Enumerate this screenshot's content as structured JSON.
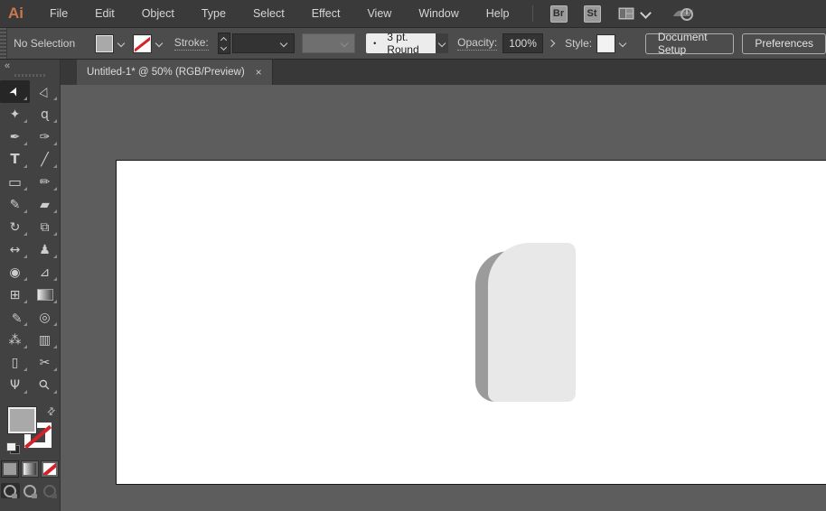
{
  "menubar": {
    "app_logo": "Ai",
    "items": [
      "File",
      "Edit",
      "Object",
      "Type",
      "Select",
      "Effect",
      "View",
      "Window",
      "Help"
    ],
    "bridge_label": "Br",
    "stock_label": "St"
  },
  "controlbar": {
    "selection_status": "No Selection",
    "stroke_label": "Stroke:",
    "brush_dot": "•",
    "brush_value": "3 pt. Round",
    "opacity_label": "Opacity:",
    "opacity_value": "100%",
    "style_label": "Style:",
    "document_setup_label": "Document Setup",
    "preferences_label": "Preferences"
  },
  "toolbar": {
    "collapse_glyph": "«",
    "tools": [
      {
        "name": "selection-tool",
        "glyph": "➤",
        "active": true
      },
      {
        "name": "direct-selection-tool",
        "glyph": "▷"
      },
      {
        "name": "magic-wand-tool",
        "glyph": "✦"
      },
      {
        "name": "lasso-tool",
        "glyph": "ɋ"
      },
      {
        "name": "pen-tool",
        "glyph": "✒"
      },
      {
        "name": "curvature-tool",
        "glyph": "✑"
      },
      {
        "name": "type-tool",
        "glyph": "T"
      },
      {
        "name": "line-segment-tool",
        "glyph": "╱"
      },
      {
        "name": "rectangle-tool",
        "glyph": "▭"
      },
      {
        "name": "paintbrush-tool",
        "glyph": "✏"
      },
      {
        "name": "shaper-tool",
        "glyph": "✎"
      },
      {
        "name": "eraser-tool",
        "glyph": "▰"
      },
      {
        "name": "rotate-tool",
        "glyph": "↻"
      },
      {
        "name": "scale-tool",
        "glyph": "⧉"
      },
      {
        "name": "width-tool",
        "glyph": "↔"
      },
      {
        "name": "puppet-warp-tool",
        "glyph": "♟"
      },
      {
        "name": "shape-builder-tool",
        "glyph": "◉"
      },
      {
        "name": "perspective-grid-tool",
        "glyph": "⊿"
      },
      {
        "name": "mesh-tool",
        "glyph": "⊞"
      },
      {
        "name": "gradient-tool",
        "glyph": "▤"
      },
      {
        "name": "eyedropper-tool",
        "glyph": "✐"
      },
      {
        "name": "blend-tool",
        "glyph": "◎"
      },
      {
        "name": "symbol-sprayer-tool",
        "glyph": "⁂"
      },
      {
        "name": "column-graph-tool",
        "glyph": "▥"
      },
      {
        "name": "artboard-tool",
        "glyph": "▯"
      },
      {
        "name": "slice-tool",
        "glyph": "✂"
      },
      {
        "name": "hand-tool",
        "glyph": "Ψ"
      },
      {
        "name": "zoom-tool",
        "glyph": "⚲"
      }
    ],
    "swap_glyph": "⇄"
  },
  "tabbar": {
    "tab_title": "Untitled-1* @ 50% (RGB/Preview)",
    "close_glyph": "×"
  },
  "canvas": {
    "shape": {
      "type": "rounded-book-shape",
      "body_color": "#e8e8e8",
      "spine_color": "#9b9b9b"
    },
    "artboard_color": "#ffffff",
    "background_color": "#5d5d5d"
  },
  "colors": {
    "menubar_bg": "#3a3a3a",
    "controlbar_bg": "#4c4c4c",
    "toolbar_bg": "#424242",
    "tab_bg": "#4f4f4f",
    "accent_logo": "#c9784e",
    "none_red": "#d3222a",
    "fill_gray": "#a9a9a9"
  }
}
